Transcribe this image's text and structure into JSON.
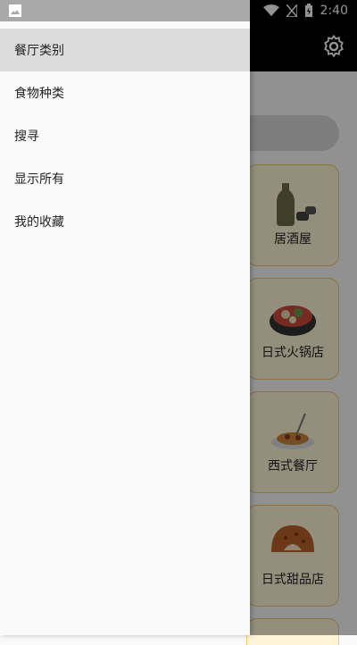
{
  "status": {
    "time": "2:40"
  },
  "drawer": {
    "items": [
      {
        "label": "餐厅类别",
        "active": true
      },
      {
        "label": "食物种类"
      },
      {
        "label": "搜寻"
      },
      {
        "label": "显示所有"
      },
      {
        "label": "我的收藏"
      }
    ]
  },
  "cards": [
    {
      "label": "居酒屋"
    },
    {
      "label": "日式火锅店"
    },
    {
      "label": "西式餐厅"
    },
    {
      "label": "日式甜品店"
    }
  ],
  "colors": {
    "card_bg": "#fff4d6",
    "card_border": "#f0c674",
    "toolbar": "#000000"
  }
}
